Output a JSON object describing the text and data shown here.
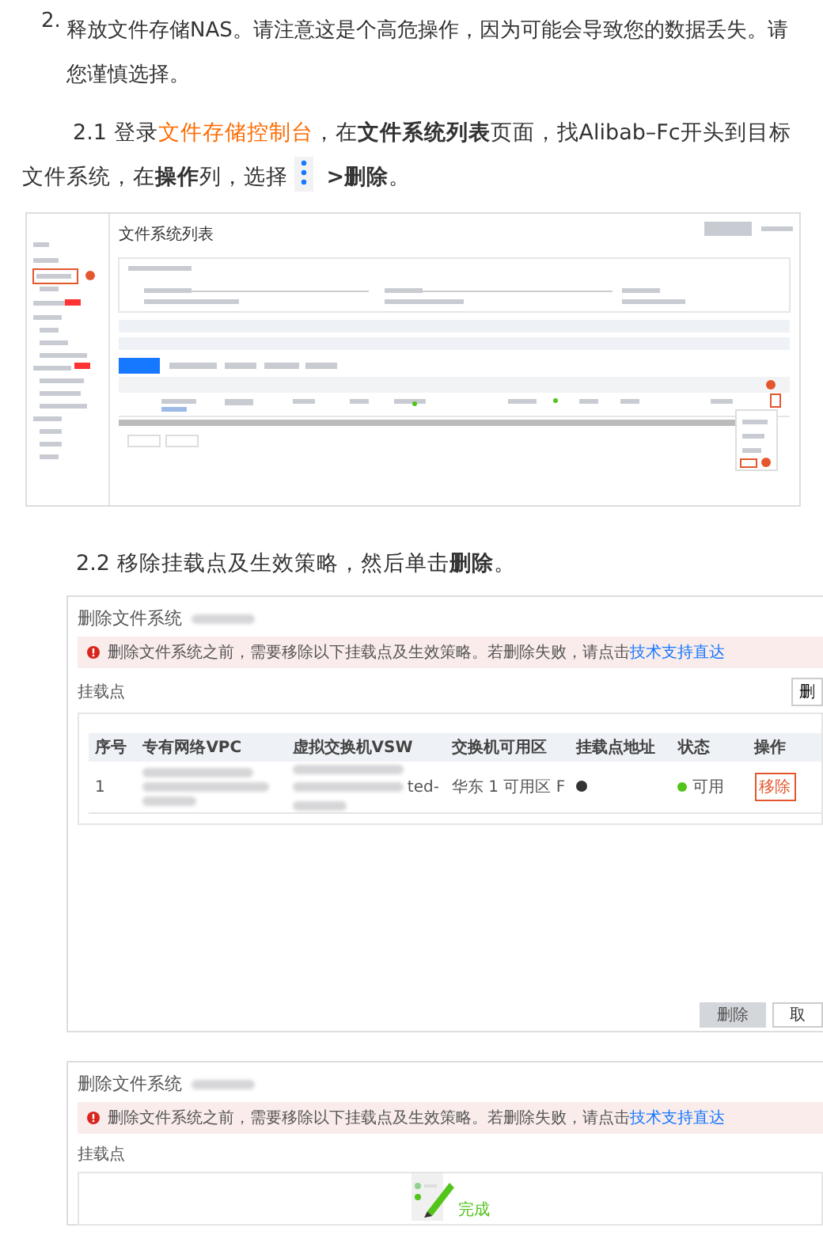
{
  "step_2": {
    "number": "2.",
    "text": "释放文件存储NAS。请注意这是个高危操作，因为可能会导致您的数据丢失。请您谨慎选择。"
  },
  "step_2_1": {
    "parts": [
      {
        "kind": "text",
        "text": "2.1 登录"
      },
      {
        "kind": "link",
        "text": "文件存储控制台"
      },
      {
        "kind": "text",
        "text": "，在**文件系统列表**页面，找Alibab–Fc开头到目标文件系统，在**操作**列，选择"
      },
      {
        "kind": "icon"
      },
      {
        "kind": "text",
        "text": " **>删除**。"
      }
    ]
  },
  "console_screenshot": {
    "title": "文件系统列表"
  },
  "step_2_2": {
    "text": "2.2 移除挂载点及生效策略，然后单击**删除**。"
  },
  "dialogs": [
    {
      "kind": "table",
      "title": "删除文件系统",
      "warning": {
        "text": "删除文件系统之前，需要移除以下挂载点及生效策略。若删除失败，请点击",
        "link": "技术支持直达"
      },
      "section_label": "挂载点",
      "side_button": "删",
      "columns": [
        "序号",
        "专有网络VPC",
        "虚拟交换机VSW",
        "交换机可用区",
        "挂载点地址",
        "状态",
        "操作"
      ],
      "rows": [
        {
          "cells": [
            {
              "kind": "text",
              "text": "1"
            },
            {
              "kind": "blurred"
            },
            {
              "kind": "blurred",
              "tail": "ted-"
            },
            {
              "kind": "text",
              "text": "华东 1 可用区 F"
            },
            {
              "kind": "icon"
            },
            {
              "kind": "status",
              "text": "可用"
            },
            {
              "kind": "action",
              "text": "移除"
            }
          ]
        }
      ],
      "buttons": [
        {
          "label": "删除",
          "disabled": true
        },
        {
          "label": "取",
          "disabled": false
        }
      ]
    },
    {
      "kind": "done",
      "title": "删除文件系统",
      "warning": {
        "text": "删除文件系统之前，需要移除以下挂载点及生效策略。若删除失败，请点击",
        "link": "技术支持直达"
      },
      "section_label": "挂载点",
      "empty_state": "完成"
    }
  ]
}
